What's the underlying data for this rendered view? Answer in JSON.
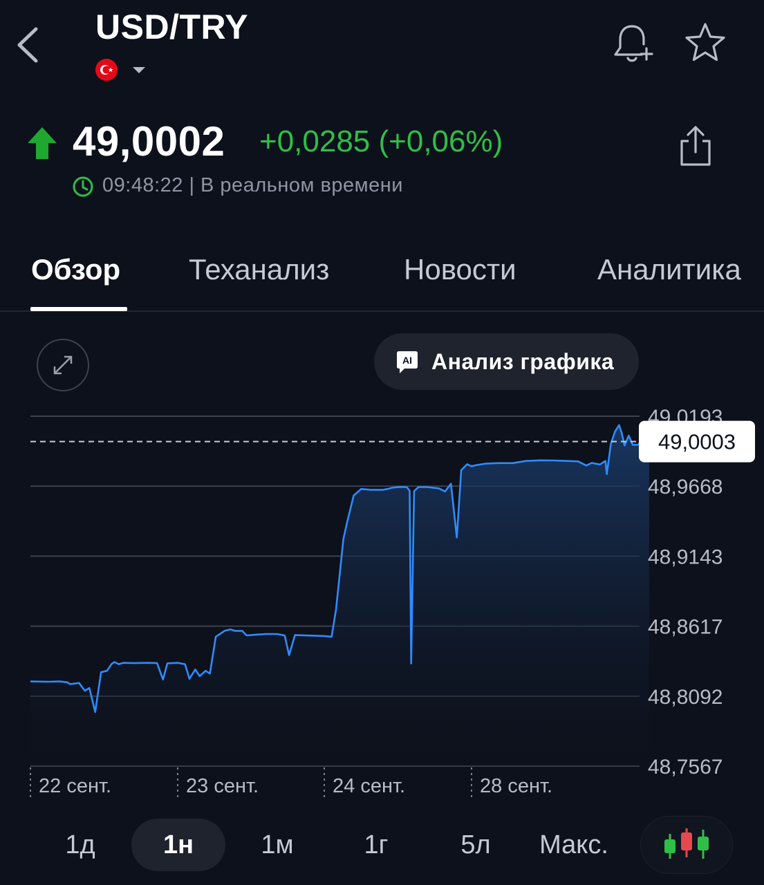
{
  "header": {
    "symbol": "USD/TRY"
  },
  "quote": {
    "price": "49,0002",
    "change": "+0,0285 (+0,06%)",
    "time_status": "09:48:22 | В реальном времени",
    "direction": "up"
  },
  "tabs": [
    {
      "label": "Обзор",
      "active": true
    },
    {
      "label": "Теханализ",
      "active": false
    },
    {
      "label": "Новости",
      "active": false
    },
    {
      "label": "Аналитика",
      "active": false
    }
  ],
  "chart_controls": {
    "analysis_label": "Анализ графика",
    "ai_badge": "AI"
  },
  "chart_data": {
    "type": "area",
    "current_value_label": "49,0003",
    "y_tick_labels": [
      "49,0193",
      "48,9668",
      "48,9143",
      "48,8617",
      "48,8092",
      "48,7567"
    ],
    "y_ticks": [
      49.0193,
      48.9668,
      48.9143,
      48.8617,
      48.8092,
      48.7567
    ],
    "ylim": [
      48.7567,
      49.0193
    ],
    "current_value": 49.0003,
    "x_tick_labels": [
      "22 сент.",
      "23 сент.",
      "24 сент.",
      "28 сент."
    ],
    "x_ticks": [
      0,
      1,
      2,
      3
    ],
    "xlim": [
      0,
      4.1
    ],
    "grid": true,
    "line_color": "#2f8cff",
    "points": [
      [
        0.0,
        48.8202
      ],
      [
        0.12,
        48.82
      ],
      [
        0.2,
        48.8202
      ],
      [
        0.25,
        48.8196
      ],
      [
        0.27,
        48.8182
      ],
      [
        0.33,
        48.8191
      ],
      [
        0.37,
        48.8132
      ],
      [
        0.4,
        48.8153
      ],
      [
        0.44,
        48.7973
      ],
      [
        0.48,
        48.8272
      ],
      [
        0.52,
        48.8282
      ],
      [
        0.55,
        48.8332
      ],
      [
        0.57,
        48.8348
      ],
      [
        0.6,
        48.8332
      ],
      [
        0.63,
        48.8342
      ],
      [
        0.7,
        48.834
      ],
      [
        0.8,
        48.8342
      ],
      [
        0.86,
        48.834
      ],
      [
        0.9,
        48.8217
      ],
      [
        0.93,
        48.8338
      ],
      [
        1.0,
        48.8342
      ],
      [
        1.05,
        48.8332
      ],
      [
        1.08,
        48.8222
      ],
      [
        1.12,
        48.8292
      ],
      [
        1.15,
        48.8242
      ],
      [
        1.19,
        48.8282
      ],
      [
        1.22,
        48.8262
      ],
      [
        1.26,
        48.8538
      ],
      [
        1.32,
        48.8582
      ],
      [
        1.36,
        48.8593
      ],
      [
        1.39,
        48.8582
      ],
      [
        1.44,
        48.8582
      ],
      [
        1.47,
        48.8548
      ],
      [
        1.52,
        48.8552
      ],
      [
        1.6,
        48.8558
      ],
      [
        1.68,
        48.8558
      ],
      [
        1.73,
        48.8547
      ],
      [
        1.76,
        48.84
      ],
      [
        1.8,
        48.855
      ],
      [
        1.9,
        48.8547
      ],
      [
        2.0,
        48.8543
      ],
      [
        2.05,
        48.8538
      ],
      [
        2.08,
        48.8741
      ],
      [
        2.13,
        48.9273
      ],
      [
        2.16,
        48.942
      ],
      [
        2.2,
        48.9598
      ],
      [
        2.25,
        48.9647
      ],
      [
        2.32,
        48.9641
      ],
      [
        2.4,
        48.9641
      ],
      [
        2.43,
        48.9647
      ],
      [
        2.46,
        48.9656
      ],
      [
        2.51,
        48.9662
      ],
      [
        2.56,
        48.9661
      ],
      [
        2.58,
        48.9634
      ],
      [
        2.59,
        48.8337
      ],
      [
        2.61,
        48.9631
      ],
      [
        2.64,
        48.9661
      ],
      [
        2.7,
        48.9661
      ],
      [
        2.78,
        48.9651
      ],
      [
        2.82,
        48.9628
      ],
      [
        2.86,
        48.9686
      ],
      [
        2.9,
        48.9283
      ],
      [
        2.93,
        48.9787
      ],
      [
        2.97,
        48.9833
      ],
      [
        3.0,
        48.9818
      ],
      [
        3.04,
        48.9827
      ],
      [
        3.1,
        48.9837
      ],
      [
        3.2,
        48.9841
      ],
      [
        3.3,
        48.9841
      ],
      [
        3.4,
        48.9857
      ],
      [
        3.5,
        48.9862
      ],
      [
        3.6,
        48.9861
      ],
      [
        3.7,
        48.9857
      ],
      [
        3.78,
        48.9854
      ],
      [
        3.84,
        48.9823
      ],
      [
        3.88,
        48.9842
      ],
      [
        3.94,
        48.9831
      ],
      [
        3.98,
        48.9858
      ],
      [
        3.99,
        48.9758
      ],
      [
        4.02,
        48.9987
      ],
      [
        4.05,
        49.0078
      ],
      [
        4.08,
        49.0126
      ],
      [
        4.1,
        49.0063
      ],
      [
        4.12,
        48.9973
      ],
      [
        4.15,
        49.0047
      ],
      [
        4.18,
        48.9978
      ],
      [
        4.22,
        48.9979
      ],
      [
        4.25,
        49.0021
      ],
      [
        4.3,
        49.0003
      ]
    ]
  },
  "ranges": [
    {
      "label": "1д",
      "active": false
    },
    {
      "label": "1н",
      "active": true
    },
    {
      "label": "1м",
      "active": false
    },
    {
      "label": "1г",
      "active": false
    },
    {
      "label": "5л",
      "active": false
    },
    {
      "label": "Макс.",
      "active": false
    }
  ],
  "colors": {
    "background": "#0d111b",
    "positive": "#2ec046",
    "accent_line": "#2f8cff"
  },
  "icons": {
    "back": "chevron-left-icon",
    "alert": "bell-plus-icon",
    "watchlist": "star-icon",
    "share": "share-icon",
    "expand": "expand-icon",
    "chart_type": "candlestick-icon"
  }
}
